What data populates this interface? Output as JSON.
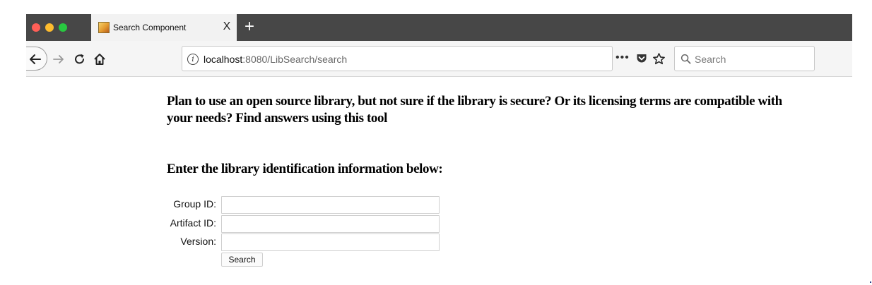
{
  "browser": {
    "tab": {
      "title": "Search Component",
      "close_glyph": "X"
    },
    "new_tab_glyph": "+",
    "address": {
      "host": "localhost",
      "path": ":8080/LibSearch/search"
    },
    "search_box": {
      "placeholder": "Search",
      "value": ""
    },
    "icons": [
      "back-arrow-icon",
      "forward-arrow-icon",
      "reload-icon",
      "home-icon",
      "info-icon",
      "more-actions-icon",
      "pocket-icon",
      "bookmark-star-icon",
      "magnifier-icon"
    ],
    "colors": {
      "tabbar": "#474747",
      "red": "#ff5f57",
      "yellow": "#febc2e",
      "green": "#28c840"
    }
  },
  "page": {
    "intro": "Plan to use an open source library, but not sure if the library is secure? Or its licensing terms are compatible with your needs? Find answers using this tool",
    "section_heading": "Enter the library identification information below:",
    "form": {
      "fields": [
        {
          "label": "Group ID:",
          "value": ""
        },
        {
          "label": "Artifact ID:",
          "value": ""
        },
        {
          "label": "Version:",
          "value": ""
        }
      ],
      "submit_label": "Search"
    }
  }
}
